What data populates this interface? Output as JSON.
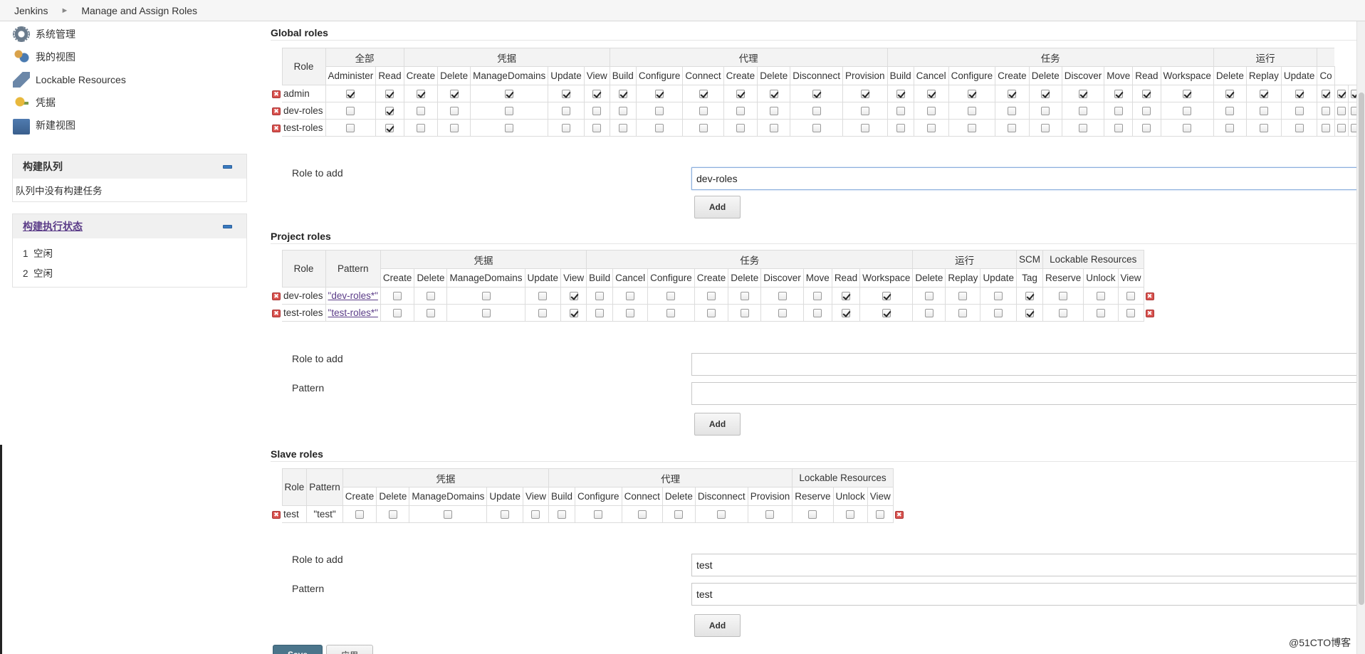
{
  "breadcrumb": {
    "root": "Jenkins",
    "current": "Manage and Assign Roles"
  },
  "sidebar": {
    "tasks": [
      {
        "label": "系统管理",
        "icon": "gear-icon"
      },
      {
        "label": "我的视图",
        "icon": "people-icon"
      },
      {
        "label": "Lockable Resources",
        "icon": "lock-icon"
      },
      {
        "label": "凭据",
        "icon": "key-icon"
      },
      {
        "label": "新建视图",
        "icon": "folder-icon"
      }
    ],
    "build_queue": {
      "title": "构建队列",
      "empty_text": "队列中没有构建任务"
    },
    "executors": {
      "title": "构建执行状态",
      "rows": [
        {
          "num": "1",
          "state": "空闲"
        },
        {
          "num": "2",
          "state": "空闲"
        }
      ]
    }
  },
  "global": {
    "title": "Global roles",
    "role_header": "Role",
    "groups": [
      {
        "label": "全部",
        "perms": [
          "Administer",
          "Read"
        ]
      },
      {
        "label": "凭据",
        "perms": [
          "Create",
          "Delete",
          "ManageDomains",
          "Update",
          "View"
        ]
      },
      {
        "label": "代理",
        "perms": [
          "Build",
          "Configure",
          "Connect",
          "Create",
          "Delete",
          "Disconnect",
          "Provision"
        ]
      },
      {
        "label": "任务",
        "perms": [
          "Build",
          "Cancel",
          "Configure",
          "Create",
          "Delete",
          "Discover",
          "Move",
          "Read",
          "Workspace"
        ]
      },
      {
        "label": "运行",
        "perms": [
          "Delete",
          "Replay",
          "Update"
        ]
      }
    ],
    "truncated_header": "Co",
    "rows": [
      {
        "role": "admin",
        "checks": [
          1,
          1,
          1,
          1,
          1,
          1,
          1,
          1,
          1,
          1,
          1,
          1,
          1,
          1,
          1,
          1,
          1,
          1,
          1,
          1,
          1,
          1,
          1,
          1,
          1,
          1,
          1,
          1,
          1
        ]
      },
      {
        "role": "dev-roles",
        "checks": [
          0,
          1,
          0,
          0,
          0,
          0,
          0,
          0,
          0,
          0,
          0,
          0,
          0,
          0,
          0,
          0,
          0,
          0,
          0,
          0,
          0,
          0,
          0,
          0,
          0,
          0,
          0,
          0,
          0
        ]
      },
      {
        "role": "test-roles",
        "checks": [
          0,
          1,
          0,
          0,
          0,
          0,
          0,
          0,
          0,
          0,
          0,
          0,
          0,
          0,
          0,
          0,
          0,
          0,
          0,
          0,
          0,
          0,
          0,
          0,
          0,
          0,
          0,
          0,
          0
        ]
      }
    ],
    "role_to_add_label": "Role to add",
    "role_to_add_value": "dev-roles",
    "add_label": "Add"
  },
  "project": {
    "title": "Project roles",
    "role_header": "Role",
    "pattern_header": "Pattern",
    "groups": [
      {
        "label": "凭据",
        "perms": [
          "Create",
          "Delete",
          "ManageDomains",
          "Update",
          "View"
        ]
      },
      {
        "label": "任务",
        "perms": [
          "Build",
          "Cancel",
          "Configure",
          "Create",
          "Delete",
          "Discover",
          "Move",
          "Read",
          "Workspace"
        ]
      },
      {
        "label": "运行",
        "perms": [
          "Delete",
          "Replay",
          "Update"
        ]
      },
      {
        "label": "SCM",
        "perms": [
          "Tag"
        ]
      },
      {
        "label": "Lockable Resources",
        "perms": [
          "Reserve",
          "Unlock",
          "View"
        ]
      }
    ],
    "rows": [
      {
        "role": "dev-roles",
        "pattern": "\"dev-roles*\"",
        "checks": [
          0,
          0,
          0,
          0,
          1,
          0,
          0,
          0,
          0,
          0,
          0,
          0,
          1,
          1,
          0,
          0,
          0,
          1,
          0,
          0,
          0
        ]
      },
      {
        "role": "test-roles",
        "pattern": "\"test-roles*\"",
        "checks": [
          0,
          0,
          0,
          0,
          1,
          0,
          0,
          0,
          0,
          0,
          0,
          0,
          1,
          1,
          0,
          0,
          0,
          1,
          0,
          0,
          0
        ]
      }
    ],
    "role_to_add_label": "Role to add",
    "pattern_label": "Pattern",
    "role_to_add_value": "",
    "pattern_value": "",
    "add_label": "Add"
  },
  "slave": {
    "title": "Slave roles",
    "role_header": "Role",
    "pattern_header": "Pattern",
    "groups": [
      {
        "label": "凭据",
        "perms": [
          "Create",
          "Delete",
          "ManageDomains",
          "Update",
          "View"
        ]
      },
      {
        "label": "代理",
        "perms": [
          "Build",
          "Configure",
          "Connect",
          "Delete",
          "Disconnect",
          "Provision"
        ]
      },
      {
        "label": "Lockable Resources",
        "perms": [
          "Reserve",
          "Unlock",
          "View"
        ]
      }
    ],
    "rows": [
      {
        "role": "test",
        "pattern": "\"test\"",
        "checks": [
          0,
          0,
          0,
          0,
          0,
          0,
          0,
          0,
          0,
          0,
          0,
          0,
          0,
          0
        ]
      }
    ],
    "role_to_add_label": "Role to add",
    "pattern_label": "Pattern",
    "role_to_add_value": "test",
    "pattern_value": "test",
    "add_label": "Add"
  },
  "footer": {
    "save_label": "Save",
    "apply_label": "应用"
  },
  "watermark": "@51CTO博客"
}
